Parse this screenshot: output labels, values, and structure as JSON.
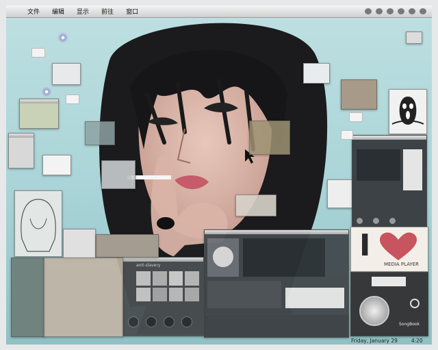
{
  "menubar": {
    "apple": "",
    "menus": [
      "文件",
      "编辑",
      "显示",
      "前往",
      "窗口"
    ]
  },
  "media_player": {
    "title": "MEDIA PLAYER",
    "letter": "I",
    "heart_color": "#c7545e"
  },
  "songbook": {
    "label": "SongBook"
  },
  "sidebar_window": {
    "title": "anti-slavery"
  },
  "clock": {
    "date": "Friday, January 29",
    "time": "4:20"
  },
  "colors": {
    "wallpaper": "#a9d4d7",
    "frame": "#e6e8ea",
    "menubar": "#dcdcdc"
  }
}
